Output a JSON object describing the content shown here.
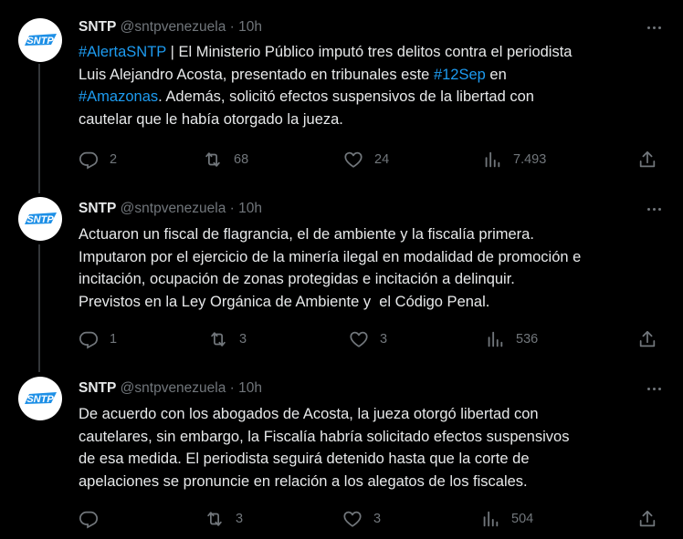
{
  "tweets": [
    {
      "name": "SNTP",
      "handle": "@sntpvenezuela",
      "dot": "·",
      "time": "10h",
      "text_parts": [
        {
          "t": "#AlertaSNTP",
          "tag": true
        },
        {
          "t": " | El Ministerio Público imputó tres delitos contra el periodista\nLuis Alejandro Acosta, presentado en tribunales este ",
          "tag": false
        },
        {
          "t": "#12Sep",
          "tag": true
        },
        {
          "t": " en\n",
          "tag": false
        },
        {
          "t": "#Amazonas",
          "tag": true
        },
        {
          "t": ". Además, solicitó efectos suspensivos de la libertad con\ncautelar que le había otorgado la jueza.",
          "tag": false
        }
      ],
      "replies": "2",
      "reposts": "68",
      "likes": "24",
      "views": "7.493"
    },
    {
      "name": "SNTP",
      "handle": "@sntpvenezuela",
      "dot": "·",
      "time": "10h",
      "text_parts": [
        {
          "t": "Actuaron un fiscal de flagrancia, el de ambiente y la fiscalía primera.\nImputaron por el ejercicio de la minería ilegal en modalidad de promoción e\nincitación, ocupación de zonas protegidas e incitación a delinquir.\nPrevistos en la Ley Orgánica de Ambiente y  el Código Penal.",
          "tag": false
        }
      ],
      "replies": "1",
      "reposts": "3",
      "likes": "3",
      "views": "536"
    },
    {
      "name": "SNTP",
      "handle": "@sntpvenezuela",
      "dot": "·",
      "time": "10h",
      "text_parts": [
        {
          "t": "De acuerdo con los abogados de Acosta, la jueza otorgó libertad con\ncautelares, sin embargo, la Fiscalía habría solicitado efectos suspensivos\nde esa medida. El periodista seguirá detenido hasta que la corte de\napelaciones se pronuncie en relación a los alegatos de los fiscales.",
          "tag": false
        }
      ],
      "replies": "",
      "reposts": "3",
      "likes": "3",
      "views": "504"
    }
  ],
  "avatar_logo_text": "SNTP",
  "colors": {
    "background": "#000000",
    "text": "#e7e9ea",
    "muted": "#71767b",
    "hashtag": "#1d9bf0",
    "thread_line": "#333639",
    "logo_blue": "#1d8fe6"
  },
  "icons": {
    "reply": "reply-icon",
    "repost": "repost-icon",
    "like": "like-icon",
    "views": "views-icon",
    "share": "share-icon",
    "more": "more-icon"
  }
}
